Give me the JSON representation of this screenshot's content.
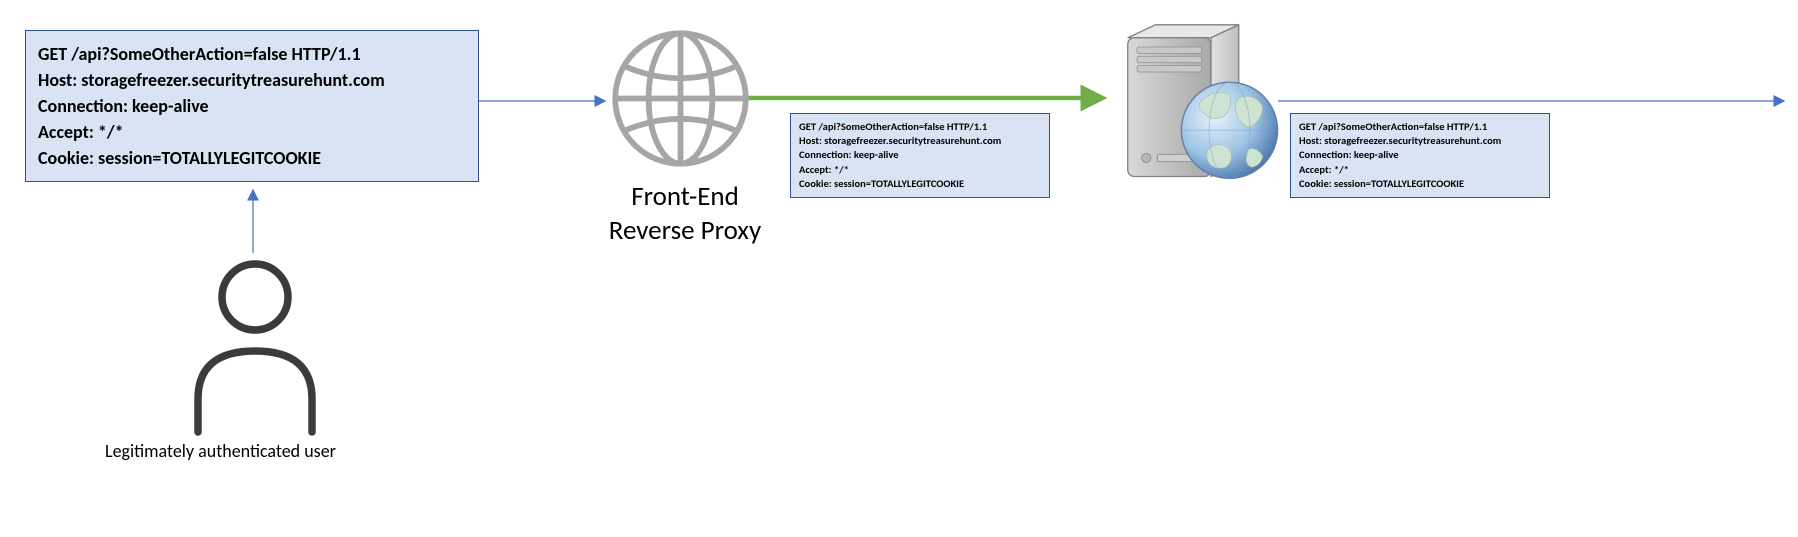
{
  "request": {
    "line1": "GET /api?SomeOtherAction=false HTTP/1.1",
    "line2": "Host: storagefreezer.securitytreasurehunt.com",
    "line3": "Connection: keep-alive",
    "line4": "Accept: */*",
    "line5": "Cookie: session=TOTALLYLEGITCOOKIE"
  },
  "labels": {
    "proxy_line1": "Front-End",
    "proxy_line2": "Reverse Proxy",
    "user": "Legitimately authenticated user"
  }
}
